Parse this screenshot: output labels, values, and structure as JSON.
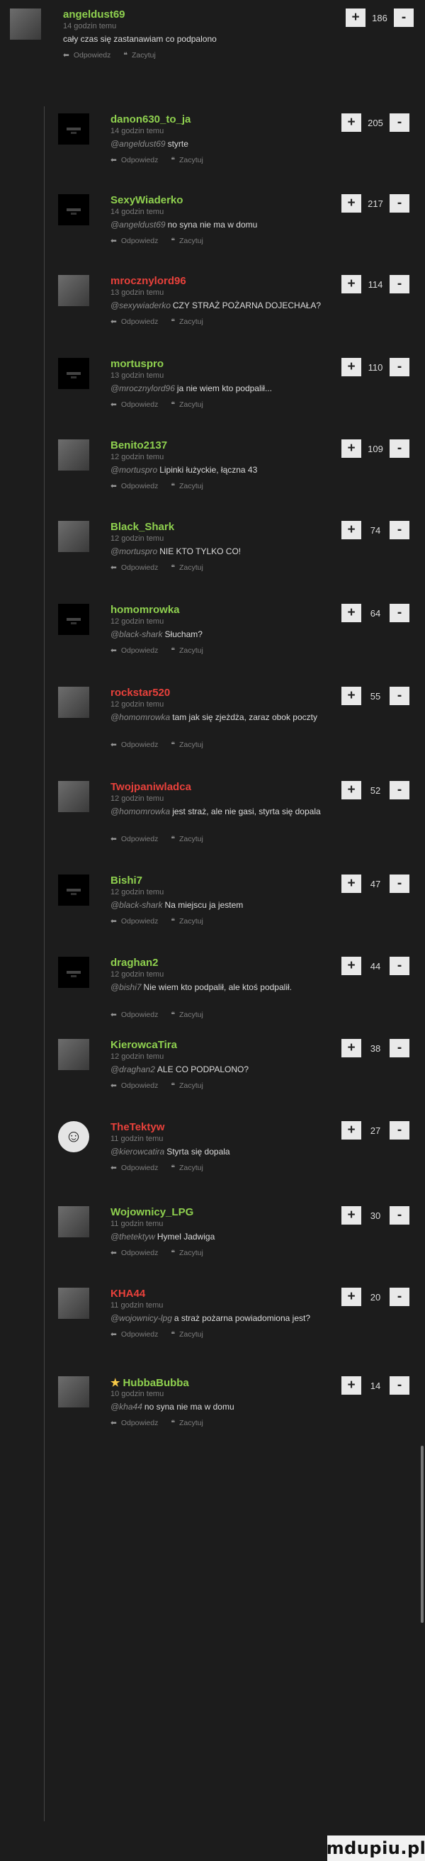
{
  "comments": [
    {
      "id": "c0",
      "user": "angeldust69",
      "user_color": "#8fd14f",
      "time": "14 godzin temu",
      "mention": "",
      "text": "cały czas się zastanawiam co podpalono",
      "votes": "186",
      "reply": "Odpowiedz",
      "report": "Zacytuj",
      "avatar": "image"
    },
    {
      "id": "c1",
      "user": "danon630_to_ja",
      "user_color": "#8fd14f",
      "time": "14 godzin temu",
      "mention": "@angeldust69",
      "text": "styrte",
      "votes": "205",
      "reply": "Odpowiedz",
      "report": "Zacytuj",
      "avatar": "blank"
    },
    {
      "id": "c2",
      "user": "SexyWiaderko",
      "user_color": "#8fd14f",
      "time": "14 godzin temu",
      "mention": "@angeldust69",
      "text": "no syna nie ma w domu",
      "votes": "217",
      "reply": "Odpowiedz",
      "report": "Zacytuj",
      "avatar": "blank"
    },
    {
      "id": "c3",
      "user": "mrocznylord96",
      "user_color": "#e8413b",
      "time": "13 godzin temu",
      "mention": "@sexywiaderko",
      "text": "CZY STRAŻ POŻARNA DOJECHAŁA?",
      "votes": "114",
      "reply": "Odpowiedz",
      "report": "Zacytuj",
      "avatar": "image"
    },
    {
      "id": "c4",
      "user": "mortuspro",
      "user_color": "#8fd14f",
      "time": "13 godzin temu",
      "mention": "@mrocznylord96",
      "text": "ja nie wiem kto podpalił...",
      "votes": "110",
      "reply": "Odpowiedz",
      "report": "Zacytuj",
      "avatar": "blank"
    },
    {
      "id": "c5",
      "user": "Benito2137",
      "user_color": "#8fd14f",
      "time": "12 godzin temu",
      "mention": "@mortuspro",
      "text": "Lipinki łużyckie, łączna 43",
      "votes": "109",
      "reply": "Odpowiedz",
      "report": "Zacytuj",
      "avatar": "image"
    },
    {
      "id": "c6",
      "user": "Black_Shark",
      "user_color": "#8fd14f",
      "time": "12 godzin temu",
      "mention": "@mortuspro",
      "text": "NIE KTO TYLKO CO!",
      "votes": "74",
      "reply": "Odpowiedz",
      "report": "Zacytuj",
      "avatar": "image"
    },
    {
      "id": "c7",
      "user": "homomrowka",
      "user_color": "#8fd14f",
      "time": "12 godzin temu",
      "mention": "@black-shark",
      "text": "Słucham?",
      "votes": "64",
      "reply": "Odpowiedz",
      "report": "Zacytuj",
      "avatar": "blank"
    },
    {
      "id": "c8",
      "user": "rockstar520",
      "user_color": "#e8413b",
      "time": "12 godzin temu",
      "mention": "@homomrowka",
      "text": "tam jak się zjeżdża, zaraz obok poczty",
      "votes": "55",
      "reply": "Odpowiedz",
      "report": "Zacytuj",
      "avatar": "image"
    },
    {
      "id": "c9",
      "user": "Twojpaniwladca",
      "user_color": "#e8413b",
      "time": "12 godzin temu",
      "mention": "@homomrowka",
      "text": "jest straż, ale nie gasi, styrta się dopala",
      "votes": "52",
      "reply": "Odpowiedz",
      "report": "Zacytuj",
      "avatar": "image"
    },
    {
      "id": "c10",
      "user": "Bishi7",
      "user_color": "#8fd14f",
      "time": "12 godzin temu",
      "mention": "@black-shark",
      "text": "Na miejscu ja jestem",
      "votes": "47",
      "reply": "Odpowiedz",
      "report": "Zacytuj",
      "avatar": "blank"
    },
    {
      "id": "c11",
      "user": "draghan2",
      "user_color": "#8fd14f",
      "time": "12 godzin temu",
      "mention": "@bishi7",
      "text": "Nie wiem kto podpalił, ale ktoś podpalił.",
      "votes": "44",
      "reply": "Odpowiedz",
      "report": "Zacytuj",
      "avatar": "blank"
    },
    {
      "id": "c12",
      "user": "KierowcaTira",
      "user_color": "#8fd14f",
      "time": "12 godzin temu",
      "mention": "@draghan2",
      "text": "ALE CO PODPALONO?",
      "votes": "38",
      "reply": "Odpowiedz",
      "report": "Zacytuj",
      "avatar": "image"
    },
    {
      "id": "c13",
      "user": "TheTektyw",
      "user_color": "#e8413b",
      "time": "11 godzin temu",
      "mention": "@kierowcatira",
      "text": "Styrta się dopala",
      "votes": "27",
      "reply": "Odpowiedz",
      "report": "Zacytuj",
      "avatar": "icon"
    },
    {
      "id": "c14",
      "user": "Wojownicy_LPG",
      "user_color": "#8fd14f",
      "time": "11 godzin temu",
      "mention": "@thetektyw",
      "text": "Hymel Jadwiga",
      "votes": "30",
      "reply": "Odpowiedz",
      "report": "Zacytuj",
      "avatar": "image"
    },
    {
      "id": "c15",
      "user": "KHA44",
      "user_color": "#e8413b",
      "time": "11 godzin temu",
      "mention": "@wojownicy-lpg",
      "text": "a straż pożarna powiadomiona jest?",
      "votes": "20",
      "reply": "Odpowiedz",
      "report": "Zacytuj",
      "avatar": "image"
    },
    {
      "id": "c16",
      "user": "HubbaBubba",
      "user_color": "#8fd14f",
      "time": "10 godzin temu",
      "mention": "@kha44",
      "text": "no syna nie ma w domu",
      "votes": "14",
      "reply": "Odpowiedz",
      "report": "Zacytuj",
      "avatar": "image",
      "badge": "★"
    }
  ],
  "vote_plus": "+",
  "vote_minus": "-",
  "reply_icon": "reply-arrow-icon",
  "quote_icon": "quote-icon",
  "watermark": "mdupiu.pl"
}
